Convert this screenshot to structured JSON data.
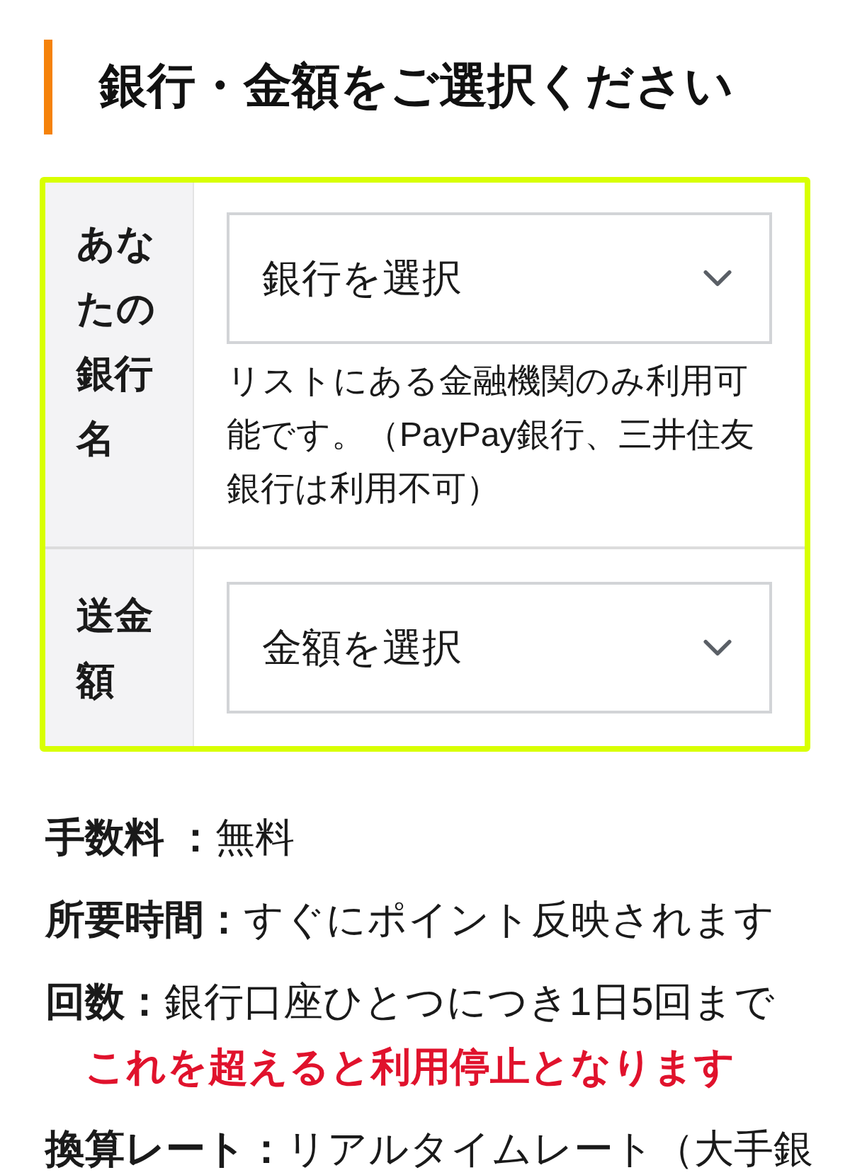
{
  "heading": {
    "title": "銀行・金額をご選択ください"
  },
  "form_rows": [
    {
      "label": "あなたの銀行名",
      "select": {
        "value": "銀行を選択"
      },
      "note": "リストにある金融機関のみ利用可能です。（PayPay銀行、三井住友銀行は利用不可）"
    },
    {
      "label": "送金額",
      "select": {
        "value": "金額を選択"
      }
    }
  ],
  "details": [
    {
      "label": "手数料 ：",
      "value": "無料"
    },
    {
      "label": "所要時間：",
      "value": "すぐにポイント反映されます"
    },
    {
      "label": "回数：",
      "value": "銀行口座ひとつにつき1日5回まで",
      "warning": "これを超えると利用停止となります"
    },
    {
      "label": "換算レート：",
      "value": "リアルタイムレート（大手銀"
    }
  ]
}
